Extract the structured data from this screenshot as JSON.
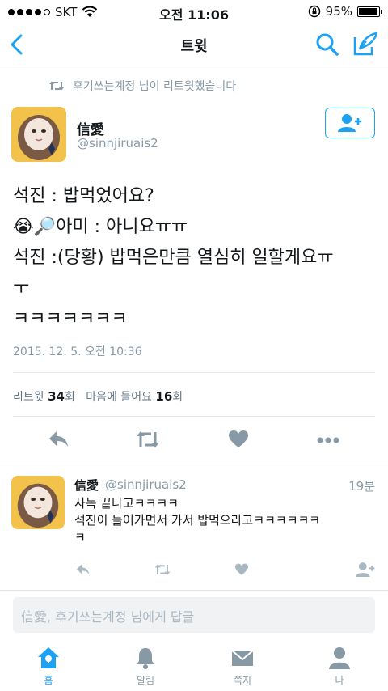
{
  "status_bar": {
    "carrier": "SKT",
    "time": "오전 11:06",
    "battery": "95%"
  },
  "nav": {
    "title": "트윗"
  },
  "retweet_context": "후기쓰는계정 님이 리트윗했습니다",
  "tweet": {
    "name": "信愛",
    "handle": "@sinnjiruais2",
    "lines": [
      "석진 : 밥먹었어요?",
      "😭🔎아미 : 아니요ㅠㅠ",
      "석진 :(당황) 밥먹은만큼 열심히 일할게요ㅠ",
      "ㅜ",
      "ㅋㅋㅋㅋㅋㅋㅋ"
    ],
    "timestamp": "2015. 12. 5. 오전 10:36",
    "stats": {
      "retweets_label": "리트윗",
      "retweets_count": "34",
      "retweets_unit": "회",
      "likes_label": "마음에 들어요",
      "likes_count": "16",
      "likes_unit": "회"
    }
  },
  "reply": {
    "name": "信愛",
    "handle": "@sinnjiruais2",
    "time": "19분",
    "lines": [
      "사녹 끝나고ㅋㅋㅋㅋ",
      "석진이 들어가면서 가서 밥먹으라고ㅋㅋㅋㅋㅋㅋ",
      "ㅋ"
    ]
  },
  "composer": {
    "placeholder": "信愛, 후기쓰는계정 님에게 답글"
  },
  "tabs": [
    {
      "label": "홈",
      "icon": "home-icon",
      "active": true
    },
    {
      "label": "알림",
      "icon": "bell-icon",
      "active": false
    },
    {
      "label": "쪽지",
      "icon": "envelope-icon",
      "active": false
    },
    {
      "label": "나",
      "icon": "person-icon",
      "active": false
    }
  ],
  "colors": {
    "accent": "#1da1f2",
    "muted": "#8899a6",
    "icon_gray": "#aab8c2"
  }
}
